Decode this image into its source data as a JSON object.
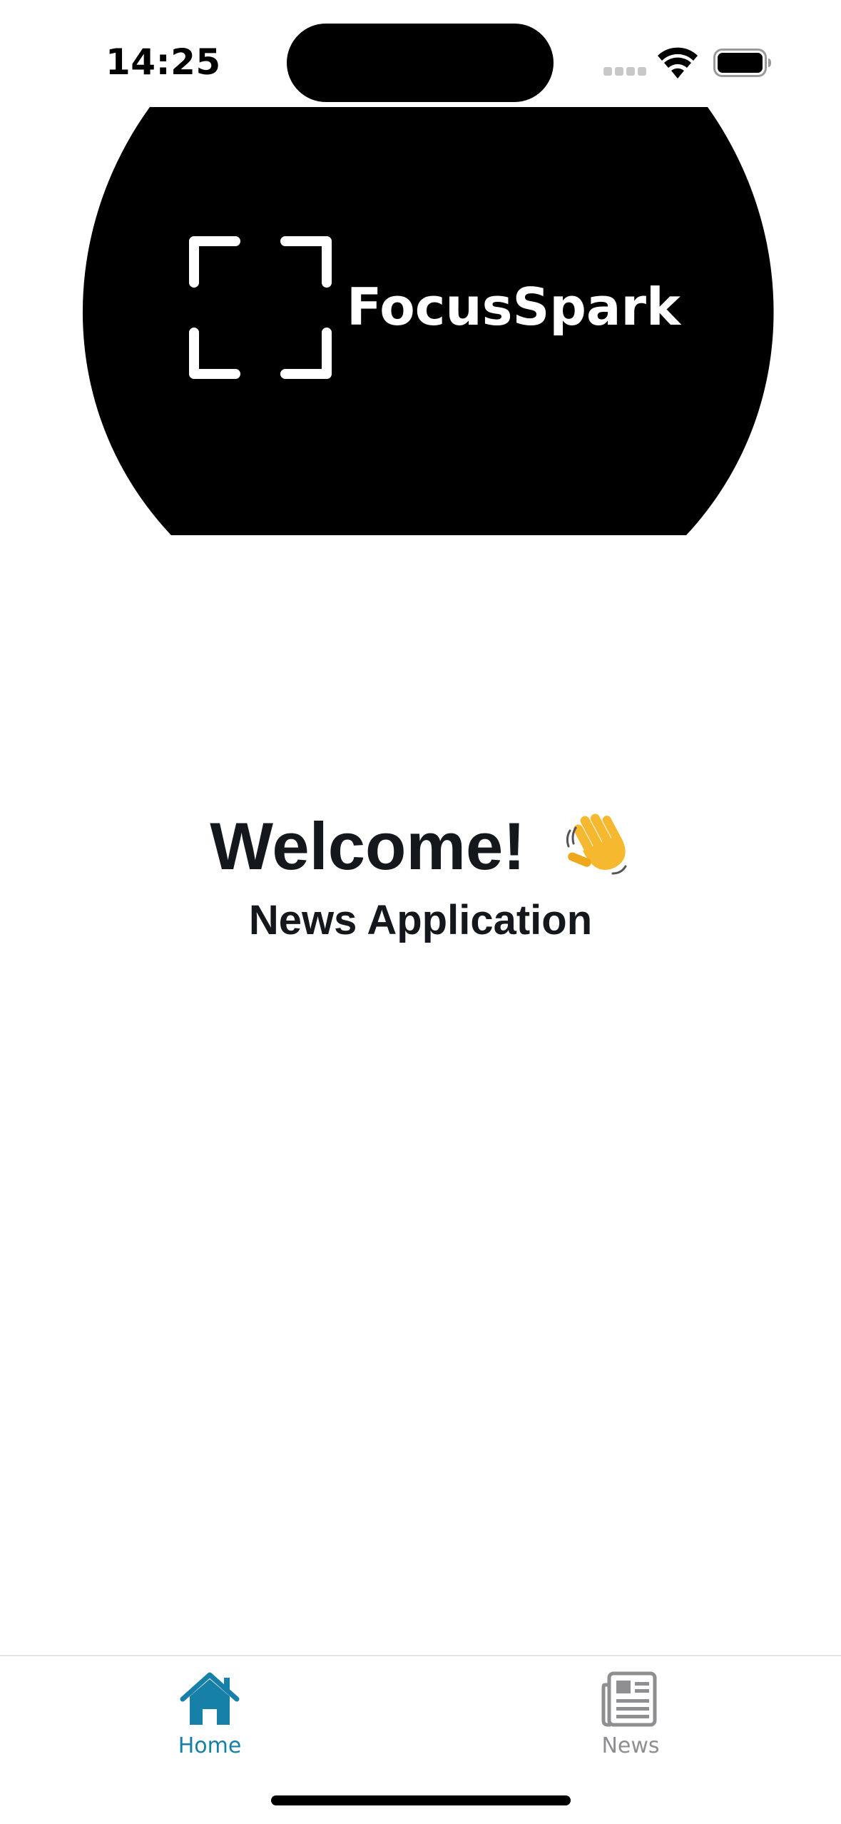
{
  "status_bar": {
    "time": "14:25",
    "icons": [
      "cellular-signal-icon",
      "wifi-icon",
      "battery-icon"
    ]
  },
  "header": {
    "app_name": "FocusSpark",
    "logo_icon": "focus-frame-icon",
    "background_color": "#000000",
    "text_color": "#ffffff"
  },
  "main": {
    "welcome_title": "Welcome!",
    "welcome_emoji_icon": "waving-hand-icon",
    "subtitle": "News Application",
    "text_color": "#14181d"
  },
  "tab_bar": {
    "tabs": [
      {
        "label": "Home",
        "icon": "house-icon",
        "selected": true,
        "color": "#1680a8"
      },
      {
        "label": "News",
        "icon": "newspaper-icon",
        "selected": false,
        "color": "#8e8e93"
      }
    ]
  }
}
